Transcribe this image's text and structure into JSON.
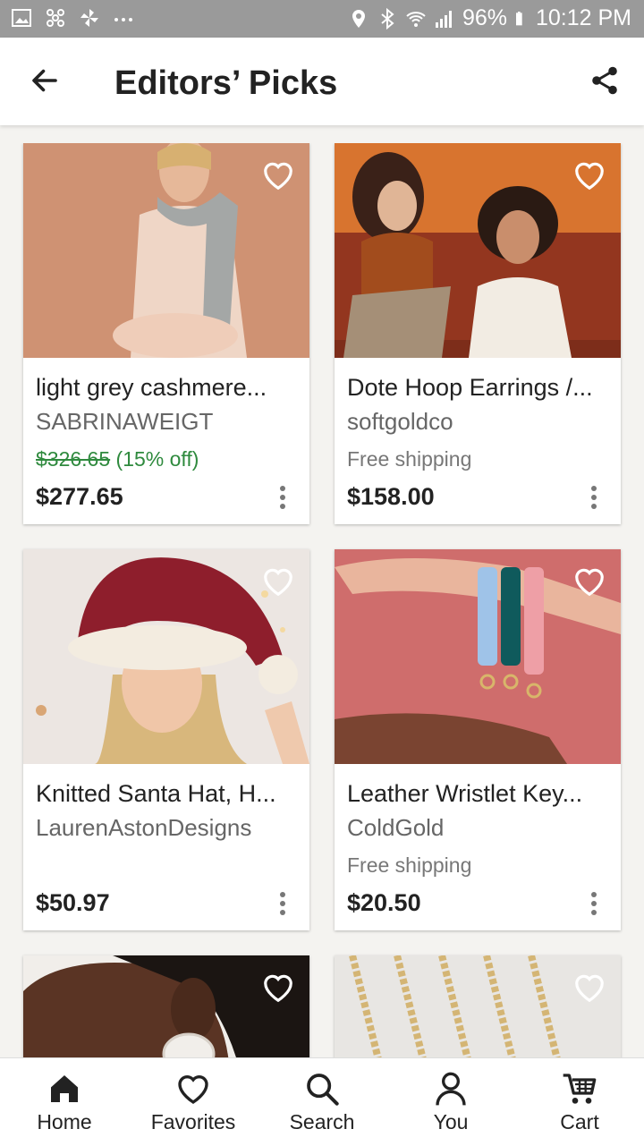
{
  "status_bar": {
    "battery": "96%",
    "time": "10:12 PM",
    "icons": [
      "image-icon",
      "pinwheel-icon",
      "fan-icon",
      "more-dots-icon",
      "location-icon",
      "bluetooth-icon",
      "wifi-icon",
      "signal-icon",
      "battery-icon"
    ]
  },
  "app_bar": {
    "title": "Editors’ Picks",
    "back_icon": "arrow-left-icon",
    "share_icon": "share-icon"
  },
  "listings": [
    {
      "name": "light grey cashmere...",
      "shop": "SABRINAWEIGT",
      "original_price": "$326.65",
      "discount": " (15% off)",
      "shipping": "",
      "price": "$277.65",
      "favorited": false
    },
    {
      "name": "Dote Hoop Earrings /...",
      "shop": "softgoldco",
      "original_price": "",
      "discount": "",
      "shipping": "Free shipping",
      "price": "$158.00",
      "favorited": false
    },
    {
      "name": "Knitted Santa Hat, H...",
      "shop": "LaurenAstonDesigns",
      "original_price": "",
      "discount": "",
      "shipping": "",
      "price": "$50.97",
      "favorited": false
    },
    {
      "name": "Leather Wristlet Key...",
      "shop": "ColdGold",
      "original_price": "",
      "discount": "",
      "shipping": "Free shipping",
      "price": "$20.50",
      "favorited": false
    }
  ],
  "bottom_nav": {
    "items": [
      {
        "label": "Home",
        "icon": "home-icon",
        "active": true
      },
      {
        "label": "Favorites",
        "icon": "heart-icon",
        "active": false
      },
      {
        "label": "Search",
        "icon": "search-icon",
        "active": false
      },
      {
        "label": "You",
        "icon": "person-icon",
        "active": false
      },
      {
        "label": "Cart",
        "icon": "cart-icon",
        "active": false
      }
    ]
  },
  "colors": {
    "sale_green": "#2f8a3e",
    "status_bar": "#9a9a9a",
    "text_dark": "#222222"
  }
}
